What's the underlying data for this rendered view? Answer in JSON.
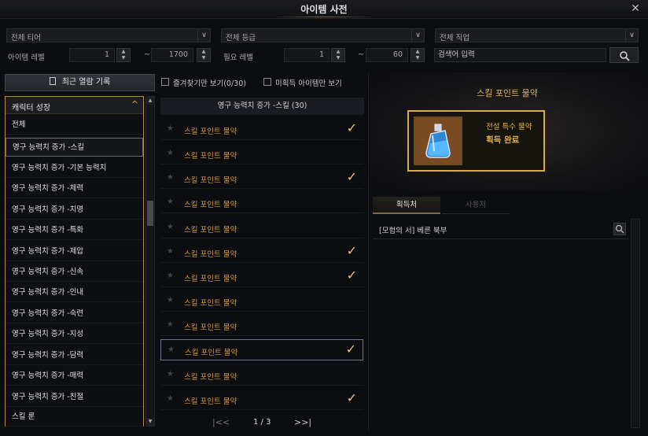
{
  "window": {
    "title": "아이템 사전"
  },
  "filters": {
    "tier": "전체 티어",
    "grade": "전체 등급",
    "job": "전체 직업",
    "item_level_label": "아이템 레벨",
    "item_level_min": "1",
    "item_level_max": "1700",
    "req_level_label": "필요 레벨",
    "req_level_min": "1",
    "req_level_max": "60",
    "tilde": "~",
    "search_placeholder": "검색어 입력"
  },
  "recent_button": "최근 열람 기록",
  "checkboxes": {
    "favorites": "즐겨찾기만 보기(0/30)",
    "unobtained": "미획득 아이템만 보기"
  },
  "category": {
    "header": "캐릭터 성장",
    "items": [
      "전체",
      "영구 능력치 증가 -스킬",
      "영구 능력치 증가 -기본 능력치",
      "영구 능력치 증가 -체력",
      "영구 능력치 증가 -치명",
      "영구 능력치 증가 -특화",
      "영구 능력치 증가 -제압",
      "영구 능력치 증가 -신속",
      "영구 능력치 증가 -인내",
      "영구 능력치 증가 -숙련",
      "영구 능력치 증가 -지성",
      "영구 능력치 증가 -담력",
      "영구 능력치 증가 -매력",
      "영구 능력치 증가 -친절",
      "스킬 룬"
    ],
    "selected_index": 1
  },
  "list": {
    "header": "영구 능력치 증가 -스킬 (30)",
    "items": [
      {
        "name": "스킬 포인트 물약",
        "obtained": true
      },
      {
        "name": "스킬 포인트 물약",
        "obtained": false
      },
      {
        "name": "스킬 포인트 물약",
        "obtained": true
      },
      {
        "name": "스킬 포인트 물약",
        "obtained": false
      },
      {
        "name": "스킬 포인트 물약",
        "obtained": false
      },
      {
        "name": "스킬 포인트 물약",
        "obtained": true
      },
      {
        "name": "스킬 포인트 물약",
        "obtained": true
      },
      {
        "name": "스킬 포인트 물약",
        "obtained": false
      },
      {
        "name": "스킬 포인트 물약",
        "obtained": false
      },
      {
        "name": "스킬 포인트 물약",
        "obtained": true
      },
      {
        "name": "스킬 포인트 물약",
        "obtained": false
      },
      {
        "name": "스킬 포인트 물약",
        "obtained": true
      }
    ],
    "selected_index": 9,
    "page": "1 / 3"
  },
  "detail": {
    "title": "스킬 포인트 물약",
    "grade_type": "전설 특수 물약",
    "status": "획득 완료",
    "tabs": [
      "획득처",
      "사용처"
    ],
    "sources": [
      "[모험의 서] 베른 북부"
    ]
  },
  "colors": {
    "accent_gold": "#d7ac4c",
    "item_name": "#d79a3c",
    "check": "#e7c57a"
  }
}
